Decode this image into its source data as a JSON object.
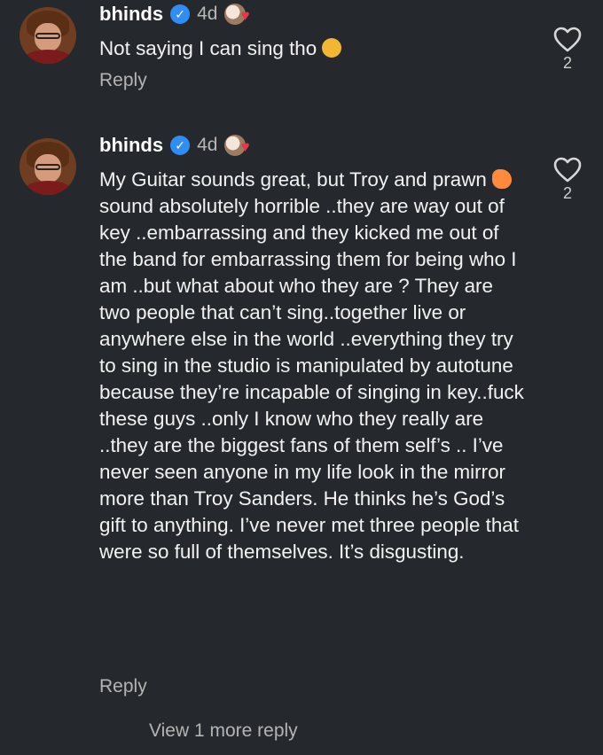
{
  "comments": [
    {
      "username": "bhinds",
      "age": "4d",
      "text": "Not saying I can sing tho",
      "reply_label": "Reply",
      "like_count": "2",
      "verified_icon": "verified-badge-icon",
      "heart_icon": "heart-outline-icon"
    },
    {
      "username": "bhinds",
      "age": "4d",
      "text_before_emoji": "My Guitar sounds great, but Troy and prawn",
      "text_after_emoji": " sound absolutely horrible ..they are way out of key ..embarrassing and they kicked me out of the band for embarrassing them for being who I am ..but what about who they are ? They are two people that can’t sing..together live or anywhere else in the world ..everything they try to sing in the studio is manipulated by autotune because they’re incapable of singing in key..fuck these guys ..only I know who they really are ..they are the biggest fans of them self’s .. I’ve never seen anyone in my life look in the mirror more than Troy Sanders. He thinks he’s God’s gift to anything. I’ve never met three people that were so full of themselves. It’s disgusting.",
      "reply_label": "Reply",
      "like_count": "2",
      "verified_icon": "verified-badge-icon",
      "heart_icon": "heart-outline-icon"
    }
  ],
  "view_more_label": "View 1 more reply",
  "colors": {
    "background": "#25282d",
    "text": "#f2f2f2",
    "muted": "#b4b4b4",
    "verified": "#2f8df5",
    "heart": "#e8364b"
  }
}
